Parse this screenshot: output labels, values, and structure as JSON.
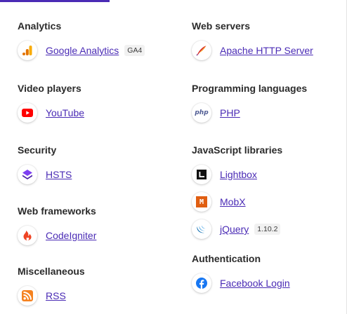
{
  "left_groups": [
    {
      "title": "Analytics",
      "items": [
        {
          "name": "Google Analytics",
          "badge": "GA4"
        }
      ]
    },
    {
      "title": "Video players",
      "items": [
        {
          "name": "YouTube"
        }
      ]
    },
    {
      "title": "Security",
      "items": [
        {
          "name": "HSTS"
        }
      ]
    },
    {
      "title": "Web frameworks",
      "items": [
        {
          "name": "CodeIgniter"
        }
      ]
    },
    {
      "title": "Miscellaneous",
      "items": [
        {
          "name": "RSS"
        }
      ]
    }
  ],
  "right_groups": [
    {
      "title": "Web servers",
      "items": [
        {
          "name": "Apache HTTP Server"
        }
      ]
    },
    {
      "title": "Programming languages",
      "items": [
        {
          "name": "PHP"
        }
      ]
    },
    {
      "title": "JavaScript libraries",
      "items": [
        {
          "name": "Lightbox"
        },
        {
          "name": "MobX"
        },
        {
          "name": "jQuery",
          "badge": "1.10.2"
        }
      ]
    },
    {
      "title": "Authentication",
      "items": [
        {
          "name": "Facebook Login"
        }
      ]
    }
  ],
  "icons": {
    "google_analytics": "google-analytics-icon",
    "youtube": "youtube-icon",
    "hsts": "hsts-icon",
    "codeigniter": "codeigniter-icon",
    "rss": "rss-icon",
    "apache": "apache-feather-icon",
    "php": "php-icon",
    "lightbox": "lightbox-icon",
    "mobx": "mobx-icon",
    "jquery": "jquery-icon",
    "facebook": "facebook-icon"
  },
  "php_icon_text": "php",
  "mobx_icon_text": "M",
  "colors": {
    "link": "#4a2bb5",
    "tab_indicator": "#4a2bb5",
    "heading": "#2b2b2b",
    "badge_bg": "#f1f1f1"
  }
}
